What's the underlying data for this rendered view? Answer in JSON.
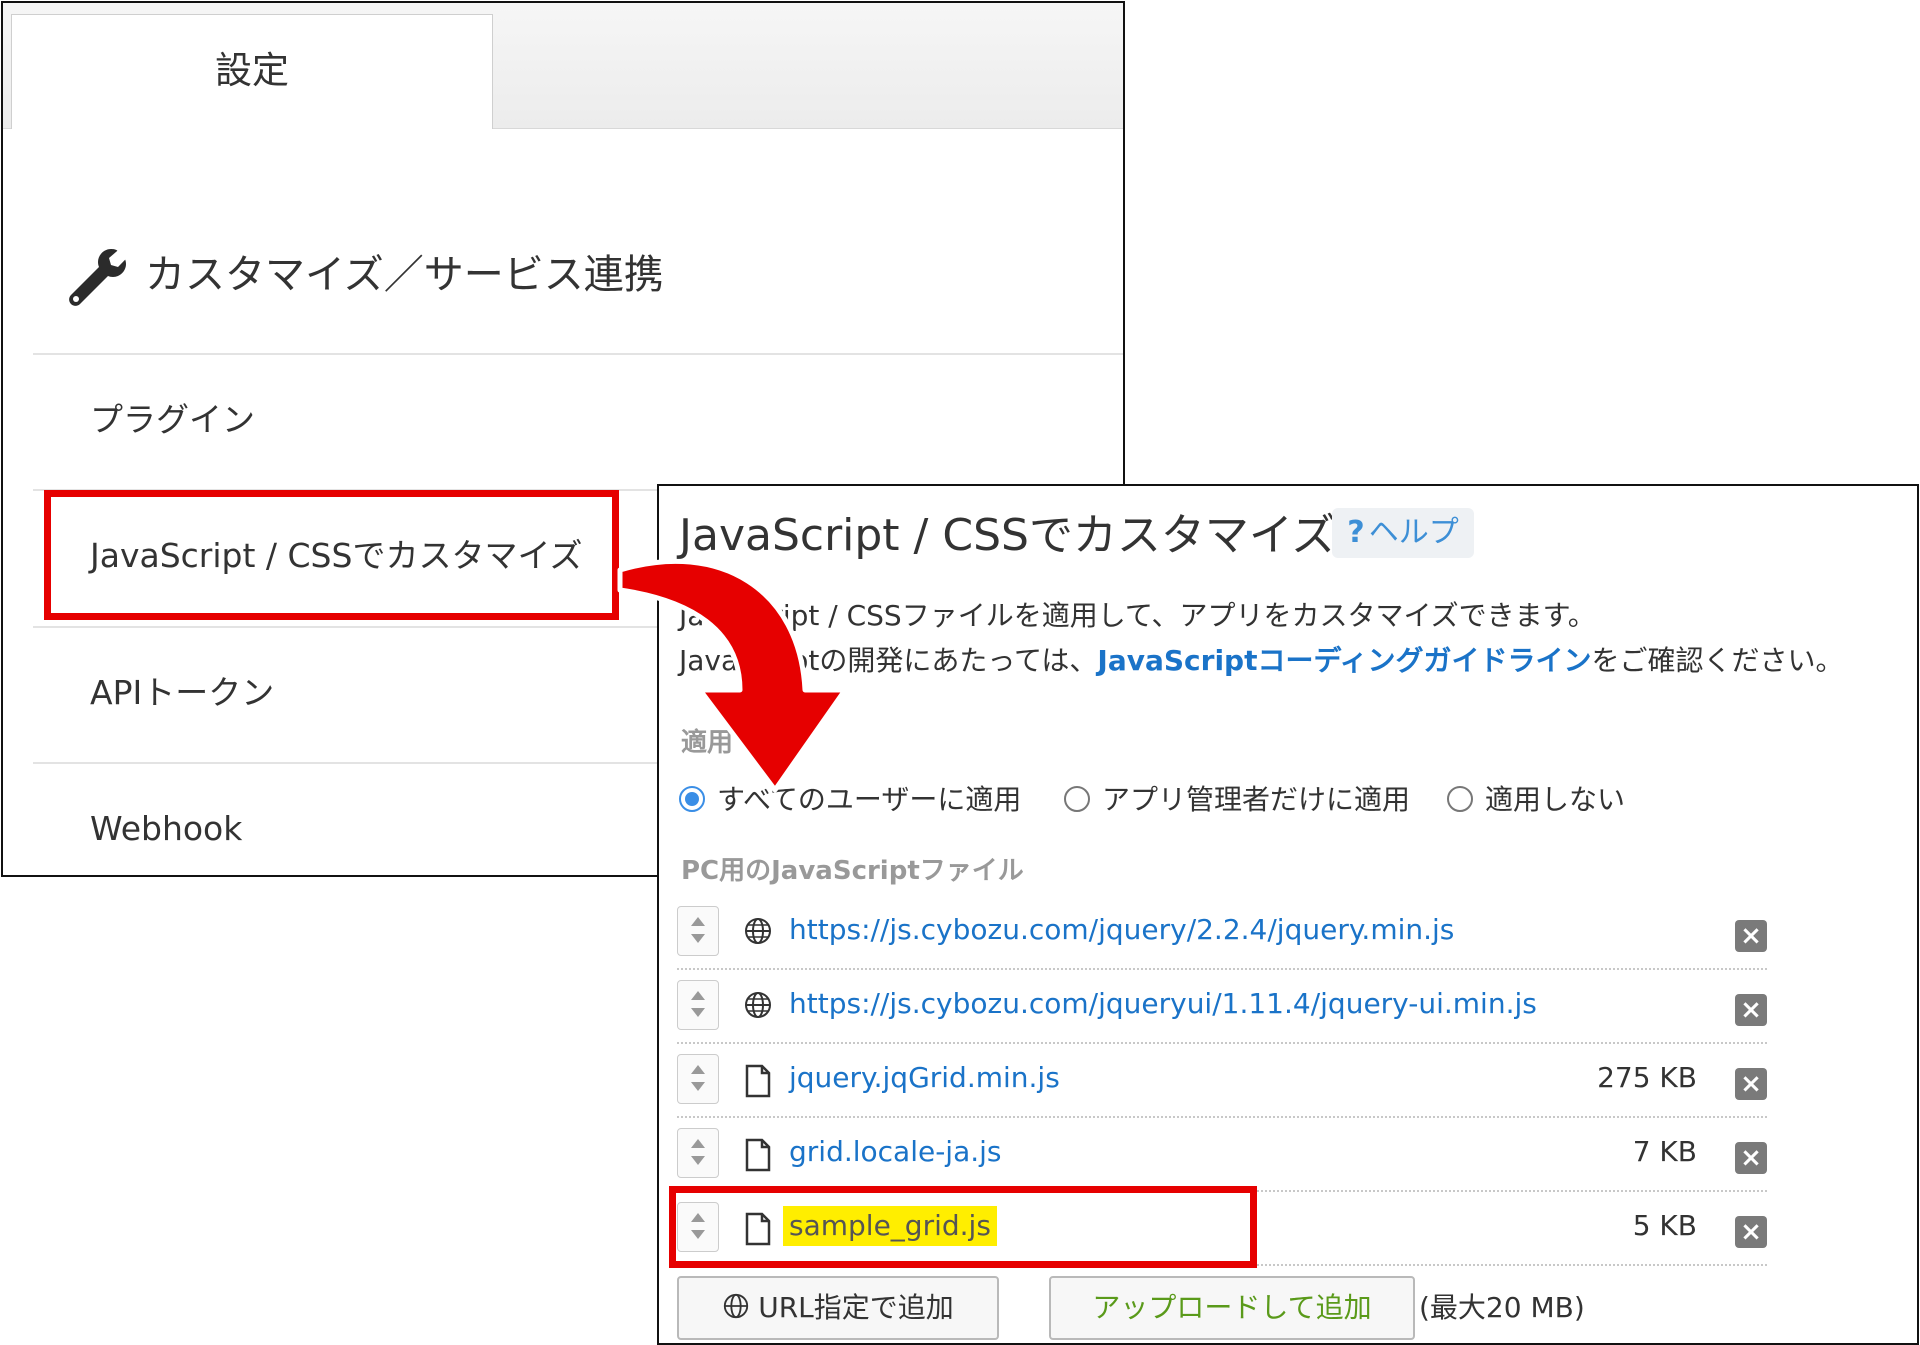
{
  "settings": {
    "tab_label": "設定",
    "section_title": "カスタマイズ／サービス連携",
    "menu_items": [
      "プラグイン",
      "JavaScript / CSSでカスタマイズ",
      "APIトークン",
      "Webhook"
    ]
  },
  "customize": {
    "title": "JavaScript / CSSでカスタマイズ",
    "help_label": "ヘルプ",
    "help_prefix": "?",
    "desc_line1": "JavaScript / CSSファイルを適用して、アプリをカスタマイズできます。",
    "desc_line2_pre": "JavaScriptの開発にあたっては、",
    "desc_line2_link": "JavaScriptコーディングガイドライン",
    "desc_line2_post": "をご確認ください。",
    "apply_label": "適用",
    "radios": [
      "すべてのユーザーに適用",
      "アプリ管理者だけに適用",
      "適用しない"
    ],
    "selected_radio": 0,
    "pc_js_label": "PC用のJavaScriptファイル",
    "files": [
      {
        "name": "https://js.cybozu.com/jquery/2.2.4/jquery.min.js",
        "type": "url",
        "size": ""
      },
      {
        "name": "https://js.cybozu.com/jqueryui/1.11.4/jquery-ui.min.js",
        "type": "url",
        "size": ""
      },
      {
        "name": "jquery.jqGrid.min.js",
        "type": "file",
        "size": "275 KB"
      },
      {
        "name": "grid.locale-ja.js",
        "type": "file",
        "size": "7 KB"
      },
      {
        "name": "sample_grid.js",
        "type": "file",
        "size": "5 KB"
      }
    ],
    "add_url_label": "URL指定で追加",
    "upload_label": "アップロードして追加",
    "max_size": "(最大20 MB)"
  },
  "colors": {
    "highlight_box": "#e60000",
    "link": "#1a73c8",
    "upload_text": "#5a9a1a",
    "file_highlight": "#ffee00"
  }
}
